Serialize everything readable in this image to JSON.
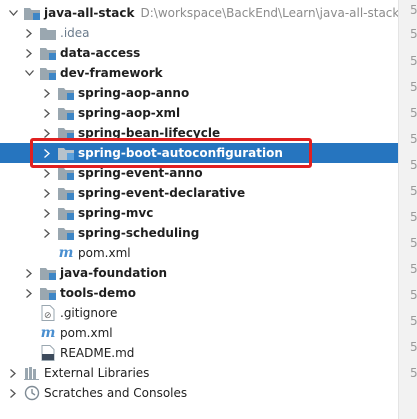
{
  "project": {
    "root_label": "java-all-stack",
    "root_path": "D:\\workspace\\BackEnd\\Learn\\java-all-stack"
  },
  "tree": {
    "idea": ".idea",
    "data_access": "data-access",
    "dev_framework": "dev-framework",
    "spring_aop_anno": "spring-aop-anno",
    "spring_aop_xml": "spring-aop-xml",
    "spring_bean_lifecycle": "spring-bean-lifecycle",
    "spring_boot_autoconfiguration": "spring-boot-autoconfiguration",
    "spring_event_anno": "spring-event-anno",
    "spring_event_declarative": "spring-event-declarative",
    "spring_mvc": "spring-mvc",
    "spring_scheduling": "spring-scheduling",
    "dev_pom": "pom.xml",
    "java_foundation": "java-foundation",
    "tools_demo": "tools-demo",
    "gitignore": ".gitignore",
    "root_pom": "pom.xml",
    "readme": "README.md",
    "external_libraries": "External Libraries",
    "scratches": "Scratches and Consoles"
  },
  "gutter_numbers": [
    "5",
    "5",
    "5",
    "5",
    "5",
    "5",
    "5",
    "5",
    "5",
    "5",
    "5",
    "5",
    "5",
    "5",
    "5"
  ],
  "colors": {
    "selection": "#2675bf",
    "highlight_box": "#e02020",
    "folder": "#9aa7b0",
    "module_badge": "#3d86c6"
  }
}
